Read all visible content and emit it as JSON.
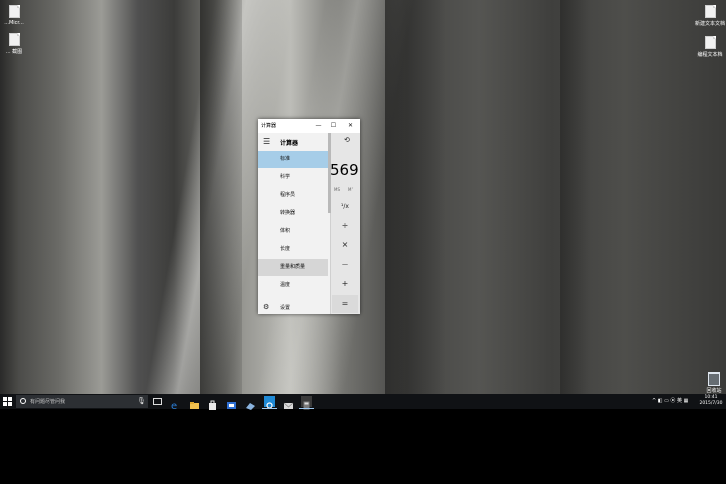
{
  "desktop": {
    "icons": [
      {
        "name": "file-icon",
        "label": "...Micr..."
      },
      {
        "name": "file-icon",
        "label": "... 截图"
      },
      {
        "name": "file-icon",
        "label": "新建文本文档"
      },
      {
        "name": "file-icon",
        "label": "编程文本档"
      }
    ],
    "recycle_bin": {
      "label": "回收站"
    }
  },
  "calculator": {
    "title": "计算器",
    "minimize": "—",
    "maximize": "☐",
    "close": "✕",
    "nav_title": "计算器",
    "nav_items": [
      {
        "label": "标准",
        "state": "selected"
      },
      {
        "label": "科学"
      },
      {
        "label": "程序员"
      },
      {
        "label": "转换器"
      },
      {
        "label": "体积"
      },
      {
        "label": "长度"
      },
      {
        "label": "重量和质量",
        "state": "hover"
      },
      {
        "label": "温度"
      }
    ],
    "settings_label": "设置",
    "display_value": "569",
    "memory": {
      "ms": "MS",
      "m_dropdown": "M˅"
    },
    "operators": {
      "reciprocal": "¹/x",
      "divide": "÷",
      "multiply": "×",
      "minus": "—",
      "plus": "+",
      "equals": "="
    },
    "colors": {
      "selected": "#a6cde8",
      "pane": "#f2f2f2",
      "body": "#e6e6e6"
    }
  },
  "taskbar": {
    "search_placeholder": "有问题尽管问我",
    "clock": {
      "time": "10:41",
      "date": "2015/7/30"
    },
    "tray_text": "^ ◧ ▭ ⦿ 英 ▦",
    "apps": [
      {
        "name": "edge-icon",
        "color": "#2b7fd8"
      },
      {
        "name": "file-explorer-icon",
        "color": "#f2c14e"
      },
      {
        "name": "store-icon",
        "color": "#e9e9e9"
      },
      {
        "name": "mail-icon",
        "color": "#2d6ed2"
      },
      {
        "name": "app-icon",
        "color": "#8ab4e0"
      },
      {
        "name": "settings-app-icon",
        "color": "#1f8ad6"
      },
      {
        "name": "envelope-icon",
        "color": "#d9d9d9"
      },
      {
        "name": "calculator-icon",
        "color": "#7a7a7a"
      }
    ]
  }
}
